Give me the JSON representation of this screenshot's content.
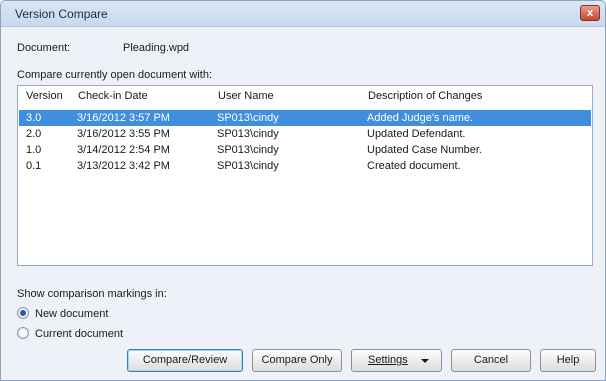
{
  "window": {
    "title": "Version Compare",
    "close_glyph": "x"
  },
  "document": {
    "label": "Document:",
    "value": "Pleading.wpd"
  },
  "compare_label": "Compare currently open document with:",
  "list": {
    "columns": [
      "Version",
      "Check-in Date",
      "User Name",
      "Description of Changes"
    ],
    "rows": [
      {
        "version": "3.0",
        "date": "3/16/2012 3:57 PM",
        "user": "SP013\\cindy",
        "desc": "Added Judge's name.",
        "selected": true
      },
      {
        "version": "2.0",
        "date": "3/16/2012 3:55 PM",
        "user": "SP013\\cindy",
        "desc": "Updated Defendant.",
        "selected": false
      },
      {
        "version": "1.0",
        "date": "3/14/2012 2:54 PM",
        "user": "SP013\\cindy",
        "desc": "Updated Case Number.",
        "selected": false
      },
      {
        "version": "0.1",
        "date": "3/13/2012 3:42 PM",
        "user": "SP013\\cindy",
        "desc": "Created document.",
        "selected": false
      }
    ]
  },
  "markings": {
    "label": "Show comparison markings in:",
    "options": [
      {
        "label": "New document",
        "checked": true
      },
      {
        "label": "Current document",
        "checked": false
      }
    ]
  },
  "buttons": {
    "compare_review": "Compare/Review",
    "compare_only": "Compare Only",
    "settings": "Settings",
    "cancel": "Cancel",
    "help": "Help"
  },
  "colors": {
    "selection": "#3f8fde",
    "dialog_bg": "#eef2f8",
    "close_button": "#c4452f"
  }
}
